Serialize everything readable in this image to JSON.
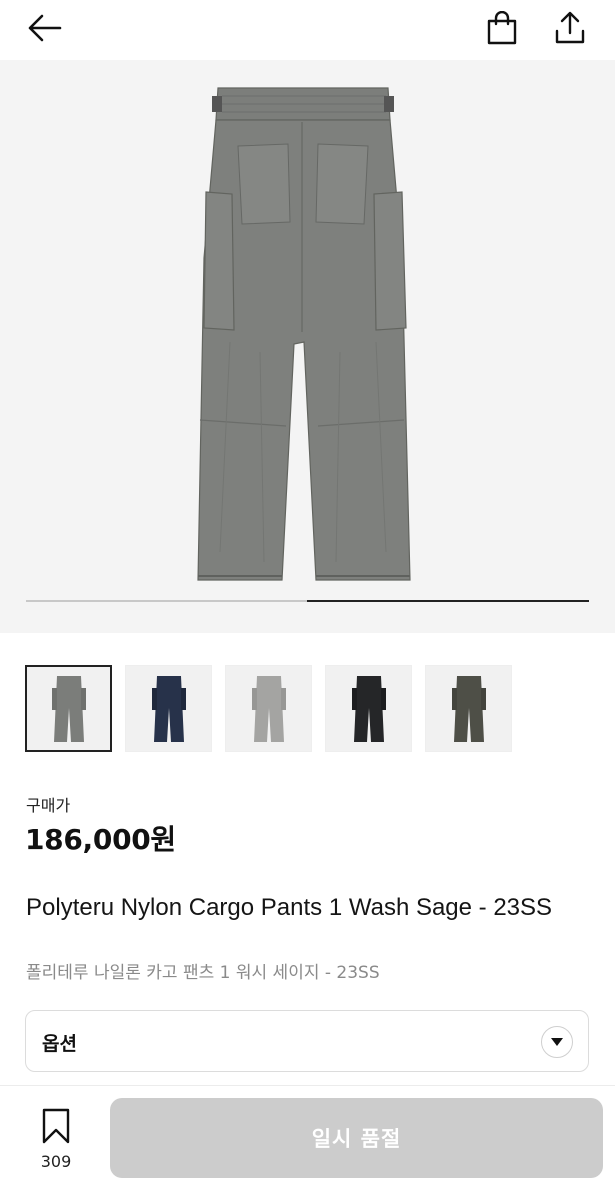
{
  "header": {
    "back_icon": "arrow-left-icon",
    "cart_icon": "shopping-bag-icon",
    "share_icon": "share-upload-icon"
  },
  "gallery": {
    "progress_fraction": 0.5,
    "thumbnails": [
      {
        "color_name": "Wash Sage",
        "color": "#7b7d7a",
        "selected": true
      },
      {
        "color_name": "Navy",
        "color": "#27324a",
        "selected": false
      },
      {
        "color_name": "Light Gray",
        "color": "#a4a4a2",
        "selected": false
      },
      {
        "color_name": "Black",
        "color": "#252628",
        "selected": false
      },
      {
        "color_name": "Olive",
        "color": "#4e4f47",
        "selected": false
      }
    ]
  },
  "product": {
    "price_label": "구매가",
    "price": "186,000원",
    "title_en": "Polyteru Nylon Cargo Pants 1 Wash Sage - 23SS",
    "title_ko": "폴리테루 나일론 카고 팬츠 1 워시 세이지 - 23SS"
  },
  "option": {
    "label": "옵션",
    "toggle_icon": "triangle-down-icon"
  },
  "bottom": {
    "wish_icon": "bookmark-icon",
    "wish_count": "309",
    "buy_label": "일시 품절",
    "buy_color": "#cccccc"
  }
}
